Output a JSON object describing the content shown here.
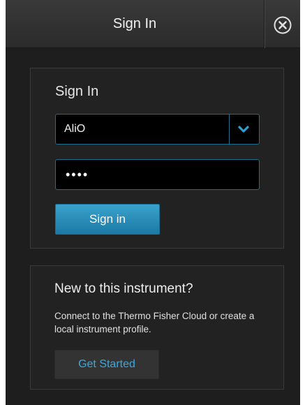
{
  "header": {
    "title": "Sign In",
    "close_icon": "close-circle-icon"
  },
  "signin_panel": {
    "heading": "Sign In",
    "username": {
      "value": "AliO",
      "dropdown_icon": "chevron-down-icon"
    },
    "password": {
      "masked_value": "••••"
    },
    "signin_button_label": "Sign in"
  },
  "new_panel": {
    "heading": "New to this instrument?",
    "description": "Connect to the Thermo Fisher Cloud or create a local instrument profile.",
    "get_started_label": "Get Started"
  },
  "colors": {
    "background": "#1e1e1e",
    "accent": "#2a8fbd",
    "link_text": "#3ea8d8"
  }
}
